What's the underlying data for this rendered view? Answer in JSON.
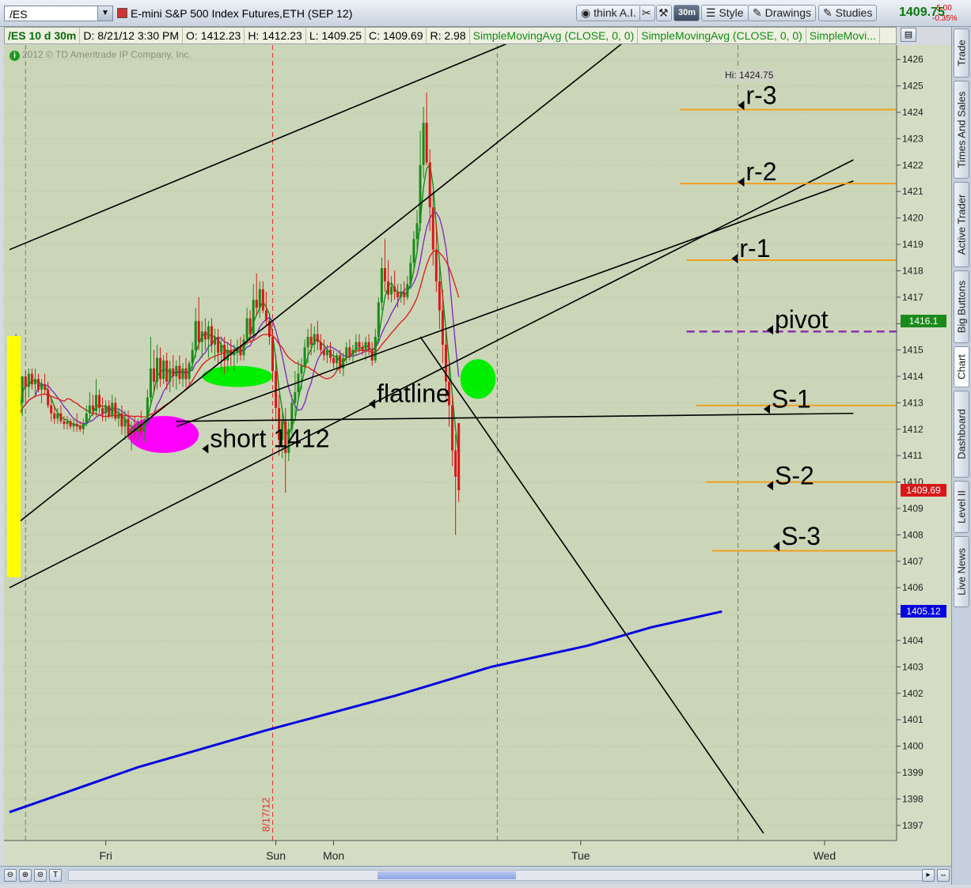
{
  "toolbar": {
    "symbol": "/ES",
    "title": "E-mini S&P 500 Index Futures,ETH (SEP 12)",
    "think_ai": "think A.I.",
    "period": "30m",
    "style": "Style",
    "drawings": "Drawings",
    "studies": "Studies",
    "last": "1409.75",
    "change": "-5.00",
    "change_pct": "-0.35%"
  },
  "infobar": {
    "symbol": "/ES 10 d 30m",
    "date": "D: 8/21/12 3:30 PM",
    "open": "O: 1412.23",
    "high": "H: 1412.23",
    "low": "L: 1409.25",
    "close": "C: 1409.69",
    "range": "R: 2.98",
    "sma1": "SimpleMovingAvg (CLOSE, 0, 0)",
    "sma2": "SimpleMovingAvg (CLOSE, 0, 0)",
    "sma3": "SimpleMovi..."
  },
  "copyright": "2012 © TD Ameritrade IP Company, Inc.",
  "sidebar": [
    "Trade",
    "Times And Sales",
    "Active Trader",
    "Big Buttons",
    "Chart",
    "Dashboard",
    "Level II",
    "Live News"
  ],
  "colors": {
    "up": "#1a8a1a",
    "down": "#d81818",
    "background": "#cbd6b8",
    "level": "#f0a020",
    "sma_long": "#0000e0"
  },
  "chart_data": {
    "type": "candlestick",
    "y_range": [
      1396.5,
      1426.5
    ],
    "y_ticks": [
      1397,
      1398,
      1399,
      1400,
      1401,
      1402,
      1403,
      1404,
      1405,
      1406,
      1407,
      1408,
      1409,
      1410,
      1411,
      1412,
      1413,
      1414,
      1415,
      1416,
      1417,
      1418,
      1419,
      1420,
      1421,
      1422,
      1423,
      1424,
      1425,
      1426
    ],
    "x_labels": [
      {
        "label": "Fri",
        "bar": 30
      },
      {
        "label": "Sun",
        "bar": 83
      },
      {
        "label": "Mon",
        "bar": 101
      },
      {
        "label": "Tue",
        "bar": 178
      },
      {
        "label": "Wed",
        "bar": 254
      }
    ],
    "session_lines": [
      5,
      152,
      227
    ],
    "date_marker": {
      "label": "8/17/12",
      "bar": 82
    },
    "hi_label": "Hi: 1424.75",
    "price_badges": [
      {
        "value": 1416.1,
        "label": "1416.1",
        "color": "#1a8a1a"
      },
      {
        "value": 1409.69,
        "label": "1409.69",
        "color": "#d81818"
      },
      {
        "value": 1405.12,
        "label": "1405.12",
        "color": "#0000e0"
      }
    ],
    "levels": [
      {
        "name": "r-3",
        "value": 1424.1,
        "from_bar": 209
      },
      {
        "name": "r-2",
        "value": 1421.3,
        "from_bar": 209
      },
      {
        "name": "r-1",
        "value": 1418.4,
        "from_bar": 211
      },
      {
        "name": "pivot",
        "value": 1415.7,
        "from_bar": 211,
        "dashed": true
      },
      {
        "name": "S-1",
        "value": 1412.9,
        "from_bar": 214
      },
      {
        "name": "S-2",
        "value": 1410.0,
        "from_bar": 217
      },
      {
        "name": "S-3",
        "value": 1407.4,
        "from_bar": 219
      }
    ],
    "annotations": [
      {
        "text": "short 1412",
        "bar": 60,
        "value": 1411.5
      },
      {
        "text": "flatline",
        "bar": 112,
        "value": 1413.2
      },
      {
        "text": "r-3",
        "bar": 227,
        "value": 1424.5
      },
      {
        "text": "r-2",
        "bar": 227,
        "value": 1421.6
      },
      {
        "text": "r-1",
        "bar": 225,
        "value": 1418.7
      },
      {
        "text": "pivot",
        "bar": 236,
        "value": 1416.0
      },
      {
        "text": "S-1",
        "bar": 235,
        "value": 1413.0
      },
      {
        "text": "S-2",
        "bar": 236,
        "value": 1410.1
      },
      {
        "text": "S-3",
        "bar": 238,
        "value": 1407.8
      }
    ],
    "trendlines": [
      {
        "from": [
          0,
          1418.8
        ],
        "to": [
          163,
          1427.0
        ]
      },
      {
        "from": [
          0,
          1408.2
        ],
        "to": [
          195,
          1427.0
        ]
      },
      {
        "from": [
          0,
          1406.0
        ],
        "to": [
          263,
          1422.2
        ]
      },
      {
        "from": [
          52,
          1412.1
        ],
        "to": [
          263,
          1421.4
        ]
      },
      {
        "from": [
          52,
          1412.3
        ],
        "to": [
          263,
          1412.6
        ]
      },
      {
        "from": [
          128,
          1415.5
        ],
        "to": [
          235,
          1396.7
        ]
      }
    ],
    "highlights": [
      {
        "bar": 48,
        "value": 1411.8,
        "w_bars": 10,
        "h_value": 1.4,
        "color": "#ff00ff"
      },
      {
        "bar": 71,
        "value": 1414.0,
        "w_bars": 10,
        "h_value": 0.8,
        "color": "#00ee00"
      },
      {
        "bar": 146,
        "value": 1413.9,
        "w_bars": 5,
        "h_value": 1.5,
        "color": "#00ee00"
      }
    ],
    "sma_long": {
      "points": [
        [
          0,
          1397.5
        ],
        [
          40,
          1399.2
        ],
        [
          80,
          1400.6
        ],
        [
          120,
          1401.9
        ],
        [
          150,
          1403.0
        ],
        [
          180,
          1403.8
        ],
        [
          200,
          1404.5
        ],
        [
          222,
          1405.1
        ]
      ]
    },
    "candles": [
      [
        1410,
        1410.8,
        1409,
        1410.5
      ],
      [
        1410.5,
        1413,
        1410.3,
        1412.5
      ],
      [
        1412.5,
        1415.6,
        1412,
        1414
      ],
      [
        1414,
        1415,
        1412.6,
        1413
      ],
      [
        1413,
        1414,
        1412.5,
        1414
      ],
      [
        1414,
        1414.2,
        1413,
        1413.6
      ],
      [
        1413.6,
        1414.3,
        1413.2,
        1414.1
      ],
      [
        1414.1,
        1414.3,
        1413.5,
        1413.7
      ],
      [
        1413.7,
        1414.3,
        1413.2,
        1413.9
      ],
      [
        1413.9,
        1414.1,
        1413.4,
        1413.5
      ],
      [
        1413.5,
        1413.9,
        1413,
        1413.7
      ],
      [
        1413.7,
        1414.1,
        1413.3,
        1413.5
      ],
      [
        1413.5,
        1413.8,
        1412.8,
        1412.9
      ],
      [
        1412.9,
        1413.2,
        1412.3,
        1412.6
      ],
      [
        1412.6,
        1412.9,
        1412.2,
        1412.4
      ],
      [
        1412.4,
        1412.8,
        1412.2,
        1412.6
      ],
      [
        1412.6,
        1412.9,
        1412.2,
        1412.3
      ],
      [
        1412.3,
        1412.5,
        1412,
        1412.2
      ],
      [
        1412.2,
        1412.5,
        1412,
        1412.3
      ],
      [
        1412.3,
        1412.4,
        1412,
        1412.1
      ],
      [
        1412.1,
        1412.4,
        1411.9,
        1412.2
      ],
      [
        1412.2,
        1412.6,
        1411.9,
        1412.1
      ],
      [
        1412.1,
        1412.3,
        1411.9,
        1412
      ],
      [
        1412,
        1412.4,
        1411.8,
        1412.2
      ],
      [
        1412.2,
        1412.9,
        1412.1,
        1412.6
      ],
      [
        1412.6,
        1413.4,
        1412.3,
        1412.9
      ],
      [
        1412.9,
        1413.3,
        1412.5,
        1412.7
      ],
      [
        1412.7,
        1413.9,
        1412.5,
        1413.3
      ],
      [
        1413.3,
        1413.5,
        1412.6,
        1412.8
      ],
      [
        1412.8,
        1413.2,
        1412.3,
        1412.6
      ],
      [
        1412.6,
        1413.1,
        1412.3,
        1412.9
      ],
      [
        1412.9,
        1413.1,
        1412.4,
        1412.5
      ],
      [
        1412.5,
        1413.3,
        1412.4,
        1413
      ],
      [
        1413,
        1413.2,
        1412.3,
        1412.4
      ],
      [
        1412.4,
        1412.8,
        1412.1,
        1412.6
      ],
      [
        1412.6,
        1412.9,
        1411.8,
        1412.1
      ],
      [
        1412.1,
        1412.7,
        1411.6,
        1412.4
      ],
      [
        1412.4,
        1412.7,
        1411.6,
        1411.8
      ],
      [
        1411.8,
        1412.3,
        1411.2,
        1412
      ],
      [
        1412,
        1412.5,
        1411.6,
        1411.9
      ],
      [
        1411.9,
        1412.4,
        1411.5,
        1412.2
      ],
      [
        1412.2,
        1412.7,
        1411.7,
        1411.9
      ],
      [
        1411.9,
        1412.4,
        1411.5,
        1412.3
      ],
      [
        1412.3,
        1413.5,
        1412.1,
        1413.2
      ],
      [
        1413.2,
        1415.5,
        1413,
        1414.3
      ],
      [
        1414.3,
        1415,
        1413.4,
        1413.8
      ],
      [
        1413.8,
        1415.2,
        1413.5,
        1414.7
      ],
      [
        1414.7,
        1415.1,
        1413.6,
        1413.9
      ],
      [
        1413.9,
        1414.8,
        1413.7,
        1414.6
      ],
      [
        1414.6,
        1414.9,
        1413.5,
        1413.8
      ],
      [
        1413.8,
        1414.6,
        1413.4,
        1414.3
      ],
      [
        1414.3,
        1414.8,
        1413.6,
        1414
      ],
      [
        1414,
        1414.6,
        1413.5,
        1414.4
      ],
      [
        1414.4,
        1414.8,
        1413.7,
        1413.9
      ],
      [
        1413.9,
        1414.5,
        1413.6,
        1414.3
      ],
      [
        1414.3,
        1414.7,
        1413.6,
        1413.9
      ],
      [
        1413.9,
        1414.6,
        1413.7,
        1414.5
      ],
      [
        1414.5,
        1415.3,
        1414.2,
        1415
      ],
      [
        1415,
        1416.6,
        1414.7,
        1416.1
      ],
      [
        1416.1,
        1417,
        1415,
        1415.3
      ],
      [
        1415.3,
        1416.1,
        1414.7,
        1415.7
      ],
      [
        1415.7,
        1416.2,
        1415,
        1415.4
      ],
      [
        1415.4,
        1416.1,
        1414.7,
        1415.9
      ],
      [
        1415.9,
        1416.2,
        1414.9,
        1415.2
      ],
      [
        1415.2,
        1415.8,
        1414.6,
        1415.5
      ],
      [
        1415.5,
        1415.8,
        1414.5,
        1414.9
      ],
      [
        1414.9,
        1415.5,
        1414.2,
        1415.2
      ],
      [
        1415.2,
        1415.5,
        1414.1,
        1414.6
      ],
      [
        1414.6,
        1415.3,
        1414.2,
        1415
      ],
      [
        1415,
        1415.4,
        1414.4,
        1414.8
      ],
      [
        1414.8,
        1415.2,
        1414.2,
        1414.9
      ],
      [
        1414.9,
        1415.4,
        1414.5,
        1415.1
      ],
      [
        1415.1,
        1415.5,
        1414.6,
        1414.8
      ],
      [
        1414.8,
        1415.6,
        1414.6,
        1415.4
      ],
      [
        1415.4,
        1416.6,
        1415.2,
        1416.2
      ],
      [
        1416.2,
        1416.5,
        1415.3,
        1415.6
      ],
      [
        1415.6,
        1417.5,
        1415.4,
        1416.9
      ],
      [
        1416.9,
        1417.9,
        1416.3,
        1416.6
      ],
      [
        1416.6,
        1417.6,
        1416.2,
        1417.3
      ],
      [
        1417.3,
        1417.6,
        1416.4,
        1416.5
      ],
      [
        1416.5,
        1417.2,
        1415.9,
        1416.1
      ],
      [
        1416.1,
        1416.4,
        1415.2,
        1415.5
      ],
      [
        1415.5,
        1415.8,
        1413.8,
        1414.2
      ],
      [
        1414.2,
        1414.8,
        1412.3,
        1412.8
      ],
      [
        1412.8,
        1413.3,
        1411,
        1411.6
      ],
      [
        1411.6,
        1412.6,
        1410.9,
        1412.3
      ],
      [
        1412.3,
        1412.8,
        1409.6,
        1411.1
      ],
      [
        1411.1,
        1412.3,
        1410.8,
        1412
      ],
      [
        1412,
        1413.3,
        1411.8,
        1413
      ],
      [
        1413,
        1414.2,
        1412.5,
        1413.4
      ],
      [
        1413.4,
        1414.6,
        1413.1,
        1414.1
      ],
      [
        1414.1,
        1414.7,
        1413.5,
        1414.4
      ],
      [
        1414.4,
        1415.4,
        1414.2,
        1415.1
      ],
      [
        1415.1,
        1415.8,
        1414.5,
        1415.5
      ],
      [
        1415.5,
        1416,
        1414.8,
        1415.2
      ],
      [
        1415.2,
        1415.9,
        1414.9,
        1415.6
      ],
      [
        1415.6,
        1416.1,
        1415,
        1415.3
      ],
      [
        1415.3,
        1415.6,
        1414.8,
        1415
      ],
      [
        1415,
        1415.4,
        1414.6,
        1414.8
      ],
      [
        1414.8,
        1415.2,
        1414.5,
        1415
      ],
      [
        1415,
        1415.3,
        1414.5,
        1414.7
      ],
      [
        1414.7,
        1415,
        1414.3,
        1414.5
      ],
      [
        1414.5,
        1414.9,
        1414.2,
        1414.8
      ],
      [
        1414.8,
        1415,
        1414.1,
        1414.3
      ],
      [
        1414.3,
        1414.9,
        1414,
        1414.7
      ],
      [
        1414.7,
        1415.3,
        1414.5,
        1415.1
      ],
      [
        1415.1,
        1415.4,
        1414.6,
        1414.8
      ],
      [
        1414.8,
        1415.2,
        1414.5,
        1415
      ],
      [
        1415,
        1415.6,
        1414.8,
        1415.3
      ],
      [
        1415.3,
        1415.6,
        1414.9,
        1415.1
      ],
      [
        1415.1,
        1415.3,
        1414.8,
        1415
      ],
      [
        1415,
        1415.5,
        1414.6,
        1415.3
      ],
      [
        1415.3,
        1415.6,
        1414.8,
        1415
      ],
      [
        1415,
        1415.3,
        1414.4,
        1414.6
      ],
      [
        1414.6,
        1415.8,
        1414.5,
        1415.5
      ],
      [
        1415.5,
        1417,
        1415.3,
        1416.8
      ],
      [
        1416.8,
        1418.5,
        1416.5,
        1418.1
      ],
      [
        1418.1,
        1419.2,
        1417.2,
        1417.6
      ],
      [
        1417.6,
        1418.4,
        1416.9,
        1417.1
      ],
      [
        1417.1,
        1417.8,
        1416.8,
        1417.4
      ],
      [
        1417.4,
        1418,
        1416.9,
        1417.2
      ],
      [
        1417.2,
        1417.5,
        1416.6,
        1417
      ],
      [
        1417,
        1417.5,
        1416.8,
        1417.2
      ],
      [
        1417.2,
        1417.6,
        1416.7,
        1417
      ],
      [
        1417,
        1417.8,
        1416.9,
        1417.5
      ],
      [
        1417.5,
        1418.6,
        1417.3,
        1418.3
      ],
      [
        1418.3,
        1419.5,
        1418,
        1419.2
      ],
      [
        1419.2,
        1420.3,
        1418.8,
        1419.8
      ],
      [
        1419.8,
        1423.3,
        1419.5,
        1422
      ],
      [
        1422,
        1424.2,
        1421.5,
        1423.6
      ],
      [
        1423.6,
        1424.75,
        1422,
        1422.1
      ],
      [
        1422.1,
        1422.6,
        1419.5,
        1420.4
      ],
      [
        1420.4,
        1421,
        1418.2,
        1418.8
      ],
      [
        1418.8,
        1419.8,
        1417.2,
        1417.6
      ],
      [
        1417.6,
        1418.3,
        1415.8,
        1416.5
      ],
      [
        1416.5,
        1417.3,
        1414.5,
        1415.2
      ],
      [
        1415.2,
        1415.8,
        1413.2,
        1413.8
      ],
      [
        1413.8,
        1414.6,
        1412.1,
        1412.9
      ],
      [
        1412.9,
        1413.3,
        1410.6,
        1411.2
      ],
      [
        1411.2,
        1411.8,
        1408,
        1410.2
      ],
      [
        1412.23,
        1412.23,
        1409.25,
        1409.69
      ]
    ]
  }
}
